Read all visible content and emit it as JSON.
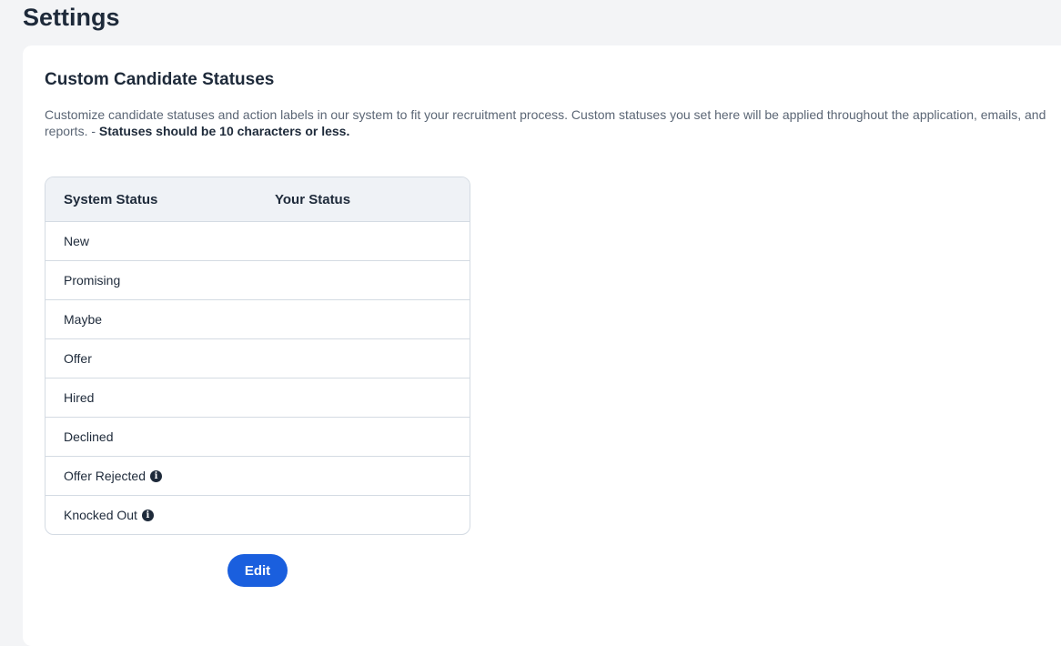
{
  "page": {
    "title": "Settings"
  },
  "section": {
    "title": "Custom Candidate Statuses",
    "description": "Customize candidate statuses and action labels in our system to fit your recruitment process. Custom statuses you set here will be applied throughout the application, emails, and reports. - ",
    "description_emphasis": "Statuses should be 10 characters or less."
  },
  "table": {
    "headers": {
      "system": "System Status",
      "yours": "Your Status"
    },
    "rows": [
      {
        "system": "New",
        "yours": ""
      },
      {
        "system": "Promising",
        "yours": ""
      },
      {
        "system": "Maybe",
        "yours": ""
      },
      {
        "system": "Offer",
        "yours": ""
      },
      {
        "system": "Hired",
        "yours": ""
      },
      {
        "system": "Declined",
        "yours": ""
      },
      {
        "system": "Offer Rejected",
        "yours": "",
        "info_icon": "info-icon"
      },
      {
        "system": "Knocked Out",
        "yours": "",
        "info_icon": "info-icon"
      }
    ]
  },
  "actions": {
    "edit_label": "Edit"
  },
  "colors": {
    "accent": "#1a5fde",
    "header_bg": "#eff2f6",
    "border": "#d4dbe3"
  }
}
